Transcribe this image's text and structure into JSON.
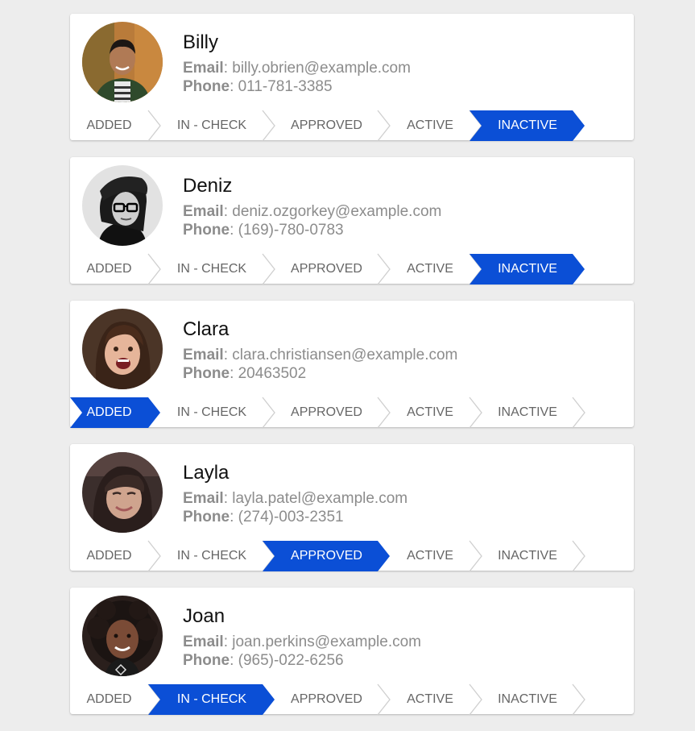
{
  "steps": [
    "ADDED",
    "IN - CHECK",
    "APPROVED",
    "ACTIVE",
    "INACTIVE"
  ],
  "labels": {
    "email": "Email",
    "phone": "Phone"
  },
  "accent_color": "#0b4fd6",
  "cards": [
    {
      "name": "Billy",
      "email": "billy.obrien@example.com",
      "phone": "011-781-3385",
      "active_step": 4,
      "avatar": "photo-man-green-jacket"
    },
    {
      "name": "Deniz",
      "email": "deniz.ozgorkey@example.com",
      "phone": "(169)-780-0783",
      "active_step": 4,
      "avatar": "photo-woman-beanie-glasses"
    },
    {
      "name": "Clara",
      "email": "clara.christiansen@example.com",
      "phone": "20463502",
      "active_step": 0,
      "avatar": "photo-woman-smiling"
    },
    {
      "name": "Layla",
      "email": "layla.patel@example.com",
      "phone": "(274)-003-2351",
      "active_step": 2,
      "avatar": "photo-woman-selfie"
    },
    {
      "name": "Joan",
      "email": "joan.perkins@example.com",
      "phone": "(965)-022-6256",
      "active_step": 1,
      "avatar": "photo-woman-curly-hair"
    }
  ]
}
